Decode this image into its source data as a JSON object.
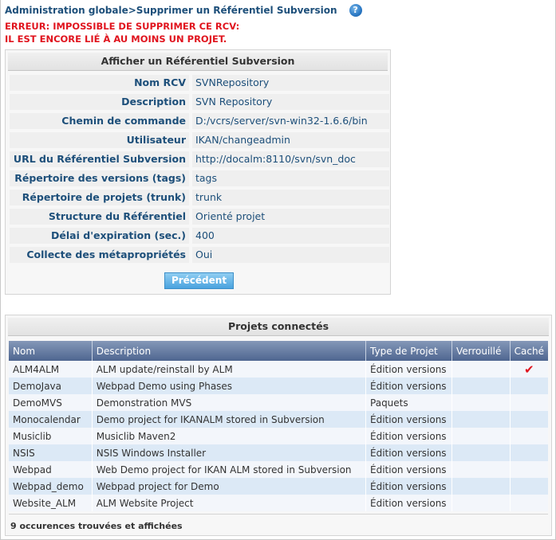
{
  "breadcrumb": "Administration globale>Supprimer un Référentiel Subversion",
  "help_icon": "help-icon",
  "error": {
    "line1": "ERREUR: IMPOSSIBLE DE SUPPRIMER CE RCV:",
    "line2": "IL EST ENCORE LIÉ À AU MOINS UN PROJET."
  },
  "details_panel": {
    "title": "Afficher un Référentiel Subversion",
    "fields": [
      {
        "label": "Nom RCV",
        "value": "SVNRepository"
      },
      {
        "label": "Description",
        "value": "SVN Repository"
      },
      {
        "label": "Chemin de commande",
        "value": "D:/vcrs/server/svn-win32-1.6.6/bin"
      },
      {
        "label": "Utilisateur",
        "value": "IKAN/changeadmin"
      },
      {
        "label": "URL du Référentiel Subversion",
        "value": "http://docalm:8110/svn/svn_doc"
      },
      {
        "label": "Répertoire des versions (tags)",
        "value": "tags"
      },
      {
        "label": "Répertoire de projets (trunk)",
        "value": "trunk"
      },
      {
        "label": "Structure du Référentiel",
        "value": "Orienté projet"
      },
      {
        "label": "Délai d'expiration (sec.)",
        "value": "400"
      },
      {
        "label": "Collecte des métapropriétés",
        "value": "Oui"
      }
    ],
    "previous_button": "Précédent"
  },
  "projects_panel": {
    "title": "Projets connectés",
    "columns": [
      "Nom",
      "Description",
      "Type de Projet",
      "Verrouillé",
      "Caché"
    ],
    "rows": [
      {
        "name": "ALM4ALM",
        "description": "ALM update/reinstall by ALM",
        "type": "Édition versions",
        "locked": "",
        "hidden": "✔"
      },
      {
        "name": "DemoJava",
        "description": "Webpad Demo using Phases",
        "type": "Édition versions",
        "locked": "",
        "hidden": ""
      },
      {
        "name": "DemoMVS",
        "description": "Demonstration MVS",
        "type": "Paquets",
        "locked": "",
        "hidden": ""
      },
      {
        "name": "Monocalendar",
        "description": "Demo project for IKANALM stored in Subversion",
        "type": "Édition versions",
        "locked": "",
        "hidden": ""
      },
      {
        "name": "Musiclib",
        "description": "Musiclib Maven2",
        "type": "Édition versions",
        "locked": "",
        "hidden": ""
      },
      {
        "name": "NSIS",
        "description": "NSIS Windows Installer",
        "type": "Édition versions",
        "locked": "",
        "hidden": ""
      },
      {
        "name": "Webpad",
        "description": "Web Demo project for IKAN ALM stored in Subversion",
        "type": "Édition versions",
        "locked": "",
        "hidden": ""
      },
      {
        "name": "Webpad_demo",
        "description": "Webpad project for Demo",
        "type": "Édition versions",
        "locked": "",
        "hidden": ""
      },
      {
        "name": "Website_ALM",
        "description": "ALM Website Project",
        "type": "Édition versions",
        "locked": "",
        "hidden": ""
      }
    ],
    "count_text": "9 occurences trouvées et affichées"
  },
  "colors": {
    "link_text": "#1d4f7a",
    "error": "#e0141e",
    "table_header": "#5e74a0",
    "button": "#4aa3df"
  }
}
